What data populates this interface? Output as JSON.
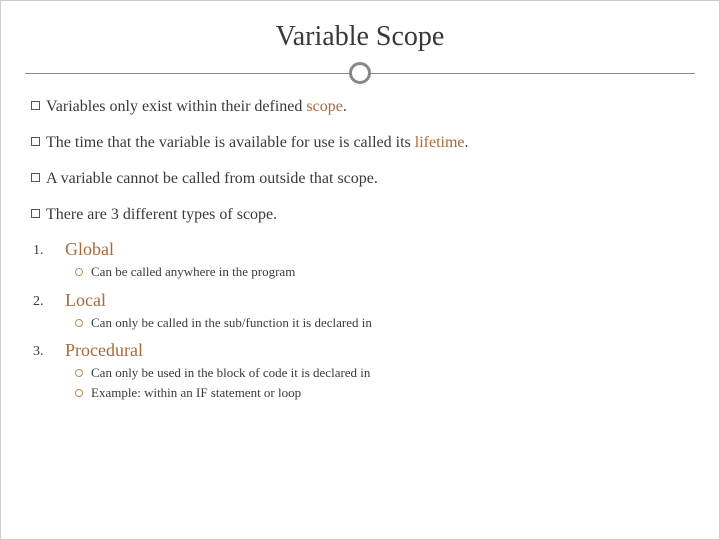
{
  "title": "Variable Scope",
  "bullets": [
    {
      "pre": "Variables only exist within their defined ",
      "accent": "scope",
      "post": "."
    },
    {
      "pre": "The time that the variable is available for use is called its ",
      "accent": "lifetime",
      "post": "."
    },
    {
      "pre": "A variable cannot be called from outside that scope.",
      "accent": "",
      "post": ""
    },
    {
      "pre": "There are 3 different types of scope.",
      "accent": "",
      "post": ""
    }
  ],
  "types": [
    {
      "num": "1.",
      "name": "Global",
      "subs": [
        "Can be called anywhere in the program"
      ]
    },
    {
      "num": "2.",
      "name": "Local",
      "subs": [
        "Can only be called in the sub/function it is declared in"
      ]
    },
    {
      "num": "3.",
      "name": "Procedural",
      "subs": [
        "Can only be used in the block of code it is declared in",
        "Example: within an IF statement or loop"
      ]
    }
  ]
}
